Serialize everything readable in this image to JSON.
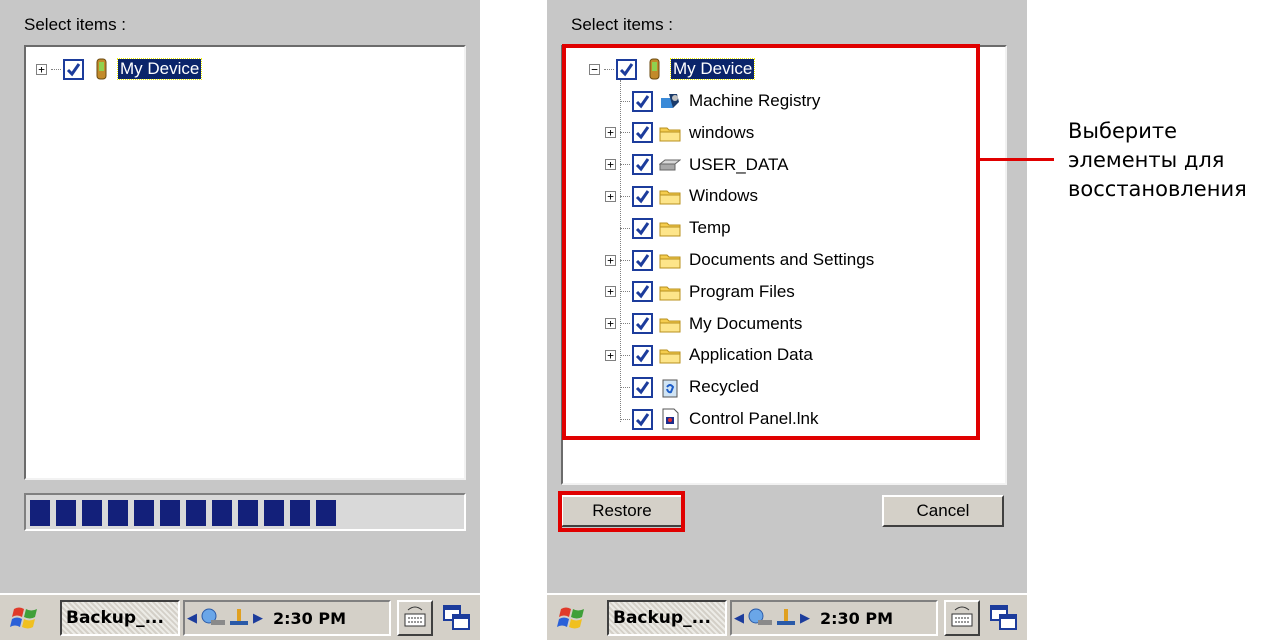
{
  "left_screen": {
    "select_label": "Select items :",
    "root_label": "My Device",
    "progress_blocks": 12
  },
  "right_screen": {
    "select_label": "Select items :",
    "root_label": "My Device",
    "items": [
      {
        "label": "Machine Registry",
        "icon": "registry-icon",
        "expandable": false
      },
      {
        "label": "windows",
        "icon": "folder-icon",
        "expandable": true
      },
      {
        "label": "USER_DATA",
        "icon": "drive-icon",
        "expandable": true
      },
      {
        "label": "Windows",
        "icon": "folder-icon",
        "expandable": true
      },
      {
        "label": "Temp",
        "icon": "folder-icon",
        "expandable": false
      },
      {
        "label": "Documents and Settings",
        "icon": "folder-icon",
        "expandable": true
      },
      {
        "label": "Program Files",
        "icon": "folder-icon",
        "expandable": true
      },
      {
        "label": "My Documents",
        "icon": "folder-icon",
        "expandable": true
      },
      {
        "label": "Application Data",
        "icon": "folder-icon",
        "expandable": true
      },
      {
        "label": "Recycled",
        "icon": "recycle-bin-icon",
        "expandable": false
      },
      {
        "label": "Control Panel.lnk",
        "icon": "shortcut-icon",
        "expandable": false
      }
    ],
    "restore_label": "Restore",
    "cancel_label": "Cancel"
  },
  "taskbar": {
    "task_label": "Backup_...",
    "clock": "2:30 PM"
  },
  "annotation": {
    "line1": "Выберите",
    "line2": "элементы для",
    "line3": "восстановления"
  },
  "colors": {
    "highlight": "#e00000",
    "selection": "#0a246a",
    "progress": "#13207a",
    "window_bg": "#c7c7c7"
  }
}
